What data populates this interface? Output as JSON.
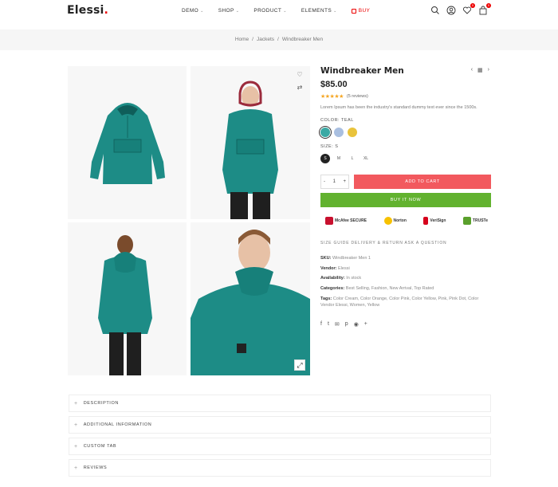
{
  "header": {
    "logo": "Elessi",
    "logo_dot": ".",
    "nav": [
      {
        "label": "DEMO"
      },
      {
        "label": "SHOP"
      },
      {
        "label": "PRODUCT"
      },
      {
        "label": "ELEMENTS"
      },
      {
        "label": "BUY"
      }
    ],
    "wishlist_count": "0",
    "cart_count": "0",
    "icons": [
      "search-icon",
      "user-icon",
      "heart-icon",
      "cart-icon"
    ]
  },
  "breadcrumb": {
    "items": [
      "Home",
      "Jackets",
      "Windbreaker Men"
    ],
    "separator": "/"
  },
  "product": {
    "title": "Windbreaker Men",
    "price": "$85.00",
    "rating_stars": "★★★★★",
    "rating_value": 5,
    "reviews": "(5 reviews)",
    "description": "Lorem Ipsum has been the industry's standard dummy text ever since the 1500s.",
    "color_label": "COLOR: TEAL",
    "colors": [
      "#3aa9a4",
      "#a9bfe0",
      "#e9c33b"
    ],
    "size_label": "SIZE: S",
    "sizes": [
      "S",
      "M",
      "L",
      "XL"
    ],
    "quantity": "1",
    "qty_minus": "-",
    "qty_plus": "+",
    "add_to_cart": "ADD TO CART",
    "buy_now": "BUY IT NOW",
    "trust_badges": [
      {
        "label": "McAfee SECURE",
        "color": "#c8102e"
      },
      {
        "label": "Norton",
        "color": "#f7c100"
      },
      {
        "label": "VeriSign",
        "color": "#d6001c"
      },
      {
        "label": "TRUSTe",
        "color": "#5aa02c"
      }
    ],
    "links": "SIZE GUIDE   DELIVERY & RETURN   ASK A QUESTION",
    "meta": {
      "sku_label": "SKU:",
      "sku_value": "Windbreaker Men 1",
      "vendor_label": "Vendor:",
      "vendor_value": "Elessi",
      "availability_label": "Availability:",
      "availability_value": "In stock",
      "categories_label": "Categories:",
      "categories_value": "Best Selling, Fashion, New Arrival, Top Rated",
      "tags_label": "Tags:",
      "tags_value": "Color Cream, Color Orange, Color Pink, Color Yellow, Pink, Pink Dot, Color Vendor Elessi, Women, Yellow"
    },
    "share_icons": [
      "f",
      "t",
      "✉",
      "p",
      "◉",
      "+"
    ]
  },
  "gallery": {
    "jacket_color": "#1d8c86",
    "zoom_icon": "⤢"
  },
  "tabs": [
    {
      "label": "DESCRIPTION"
    },
    {
      "label": "ADDITIONAL INFORMATION"
    },
    {
      "label": "CUSTOM TAB"
    },
    {
      "label": "REVIEWS"
    }
  ]
}
